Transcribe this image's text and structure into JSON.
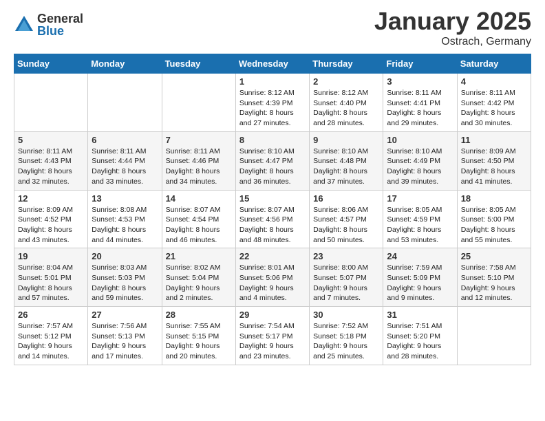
{
  "logo": {
    "general": "General",
    "blue": "Blue"
  },
  "title": "January 2025",
  "location": "Ostrach, Germany",
  "days_of_week": [
    "Sunday",
    "Monday",
    "Tuesday",
    "Wednesday",
    "Thursday",
    "Friday",
    "Saturday"
  ],
  "weeks": [
    [
      {
        "num": "",
        "info": ""
      },
      {
        "num": "",
        "info": ""
      },
      {
        "num": "",
        "info": ""
      },
      {
        "num": "1",
        "info": "Sunrise: 8:12 AM\nSunset: 4:39 PM\nDaylight: 8 hours and 27 minutes."
      },
      {
        "num": "2",
        "info": "Sunrise: 8:12 AM\nSunset: 4:40 PM\nDaylight: 8 hours and 28 minutes."
      },
      {
        "num": "3",
        "info": "Sunrise: 8:11 AM\nSunset: 4:41 PM\nDaylight: 8 hours and 29 minutes."
      },
      {
        "num": "4",
        "info": "Sunrise: 8:11 AM\nSunset: 4:42 PM\nDaylight: 8 hours and 30 minutes."
      }
    ],
    [
      {
        "num": "5",
        "info": "Sunrise: 8:11 AM\nSunset: 4:43 PM\nDaylight: 8 hours and 32 minutes."
      },
      {
        "num": "6",
        "info": "Sunrise: 8:11 AM\nSunset: 4:44 PM\nDaylight: 8 hours and 33 minutes."
      },
      {
        "num": "7",
        "info": "Sunrise: 8:11 AM\nSunset: 4:46 PM\nDaylight: 8 hours and 34 minutes."
      },
      {
        "num": "8",
        "info": "Sunrise: 8:10 AM\nSunset: 4:47 PM\nDaylight: 8 hours and 36 minutes."
      },
      {
        "num": "9",
        "info": "Sunrise: 8:10 AM\nSunset: 4:48 PM\nDaylight: 8 hours and 37 minutes."
      },
      {
        "num": "10",
        "info": "Sunrise: 8:10 AM\nSunset: 4:49 PM\nDaylight: 8 hours and 39 minutes."
      },
      {
        "num": "11",
        "info": "Sunrise: 8:09 AM\nSunset: 4:50 PM\nDaylight: 8 hours and 41 minutes."
      }
    ],
    [
      {
        "num": "12",
        "info": "Sunrise: 8:09 AM\nSunset: 4:52 PM\nDaylight: 8 hours and 43 minutes."
      },
      {
        "num": "13",
        "info": "Sunrise: 8:08 AM\nSunset: 4:53 PM\nDaylight: 8 hours and 44 minutes."
      },
      {
        "num": "14",
        "info": "Sunrise: 8:07 AM\nSunset: 4:54 PM\nDaylight: 8 hours and 46 minutes."
      },
      {
        "num": "15",
        "info": "Sunrise: 8:07 AM\nSunset: 4:56 PM\nDaylight: 8 hours and 48 minutes."
      },
      {
        "num": "16",
        "info": "Sunrise: 8:06 AM\nSunset: 4:57 PM\nDaylight: 8 hours and 50 minutes."
      },
      {
        "num": "17",
        "info": "Sunrise: 8:05 AM\nSunset: 4:59 PM\nDaylight: 8 hours and 53 minutes."
      },
      {
        "num": "18",
        "info": "Sunrise: 8:05 AM\nSunset: 5:00 PM\nDaylight: 8 hours and 55 minutes."
      }
    ],
    [
      {
        "num": "19",
        "info": "Sunrise: 8:04 AM\nSunset: 5:01 PM\nDaylight: 8 hours and 57 minutes."
      },
      {
        "num": "20",
        "info": "Sunrise: 8:03 AM\nSunset: 5:03 PM\nDaylight: 8 hours and 59 minutes."
      },
      {
        "num": "21",
        "info": "Sunrise: 8:02 AM\nSunset: 5:04 PM\nDaylight: 9 hours and 2 minutes."
      },
      {
        "num": "22",
        "info": "Sunrise: 8:01 AM\nSunset: 5:06 PM\nDaylight: 9 hours and 4 minutes."
      },
      {
        "num": "23",
        "info": "Sunrise: 8:00 AM\nSunset: 5:07 PM\nDaylight: 9 hours and 7 minutes."
      },
      {
        "num": "24",
        "info": "Sunrise: 7:59 AM\nSunset: 5:09 PM\nDaylight: 9 hours and 9 minutes."
      },
      {
        "num": "25",
        "info": "Sunrise: 7:58 AM\nSunset: 5:10 PM\nDaylight: 9 hours and 12 minutes."
      }
    ],
    [
      {
        "num": "26",
        "info": "Sunrise: 7:57 AM\nSunset: 5:12 PM\nDaylight: 9 hours and 14 minutes."
      },
      {
        "num": "27",
        "info": "Sunrise: 7:56 AM\nSunset: 5:13 PM\nDaylight: 9 hours and 17 minutes."
      },
      {
        "num": "28",
        "info": "Sunrise: 7:55 AM\nSunset: 5:15 PM\nDaylight: 9 hours and 20 minutes."
      },
      {
        "num": "29",
        "info": "Sunrise: 7:54 AM\nSunset: 5:17 PM\nDaylight: 9 hours and 23 minutes."
      },
      {
        "num": "30",
        "info": "Sunrise: 7:52 AM\nSunset: 5:18 PM\nDaylight: 9 hours and 25 minutes."
      },
      {
        "num": "31",
        "info": "Sunrise: 7:51 AM\nSunset: 5:20 PM\nDaylight: 9 hours and 28 minutes."
      },
      {
        "num": "",
        "info": ""
      }
    ]
  ]
}
